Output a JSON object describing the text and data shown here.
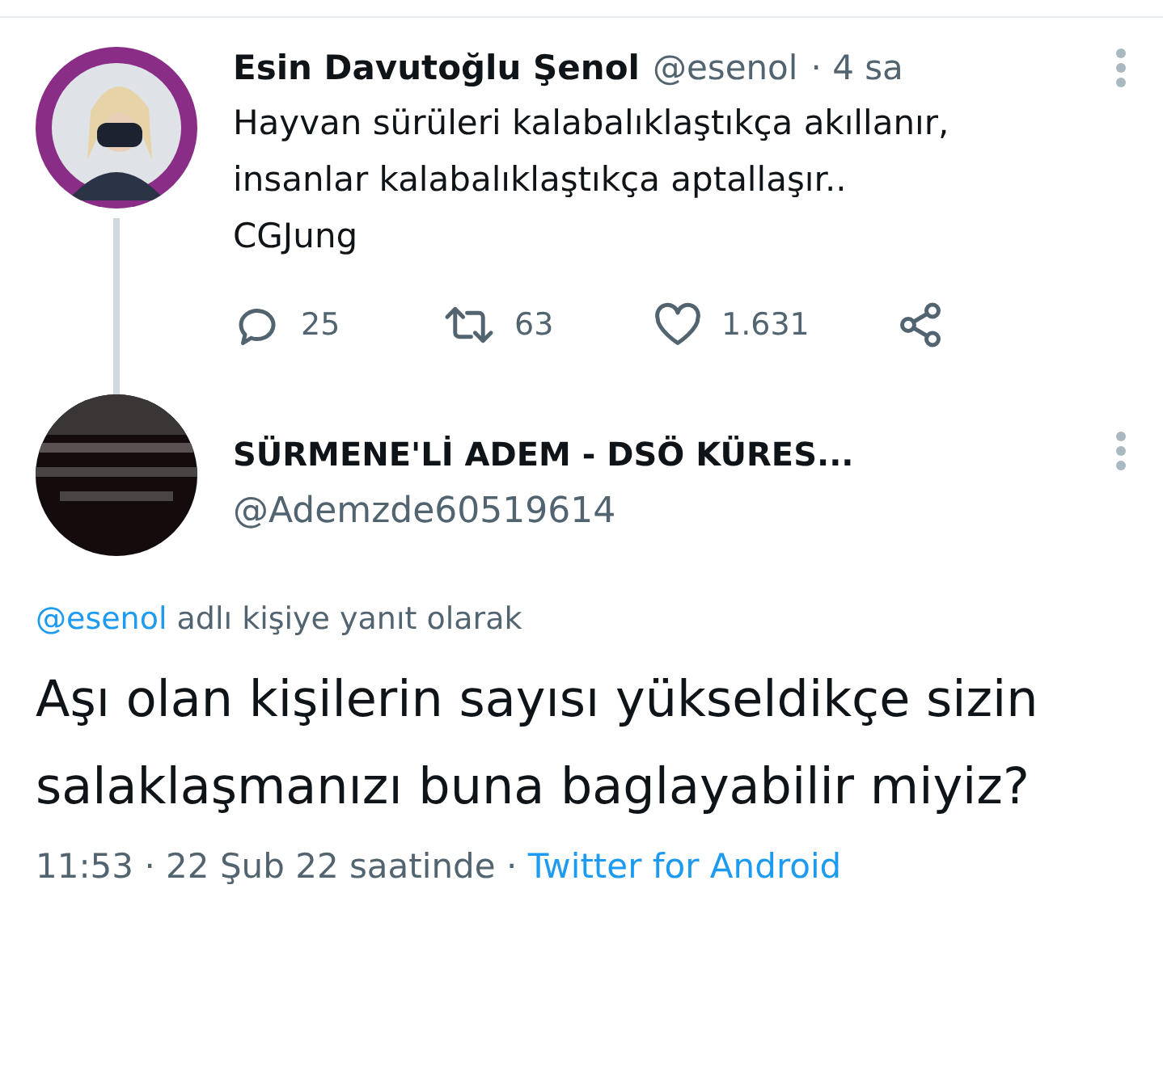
{
  "parent_tweet": {
    "author": "Esin Davutoğlu Şenol",
    "handle": "@esenol",
    "time": "· 4 sa",
    "text_lines": [
      "Hayvan sürüleri kalabalıklaştıkça akıllanır,",
      "insanlar kalabalıklaştıkça aptallaşır..",
      "CGJung"
    ],
    "actions": [
      {
        "kind": "reply",
        "count": "25"
      },
      {
        "kind": "retweet",
        "count": "63"
      },
      {
        "kind": "like",
        "count": "1.631"
      },
      {
        "kind": "share"
      }
    ]
  },
  "tweet": {
    "author": "SÜRMENE'Lİ ADEM - DSÖ KÜRES...",
    "handle": "@Ademzde60519614",
    "reply_to": "@esenol",
    "reply_text": "adlı kişiye yanıt olarak",
    "text": "Aşı olan kişilerin sayısı yükseldikçe sizin salaklaşmanızı buna baglayabilir miyiz?",
    "timestamp": "11:53 · 22 Şub 22 saatinde ·",
    "source": "Twitter for Android"
  }
}
